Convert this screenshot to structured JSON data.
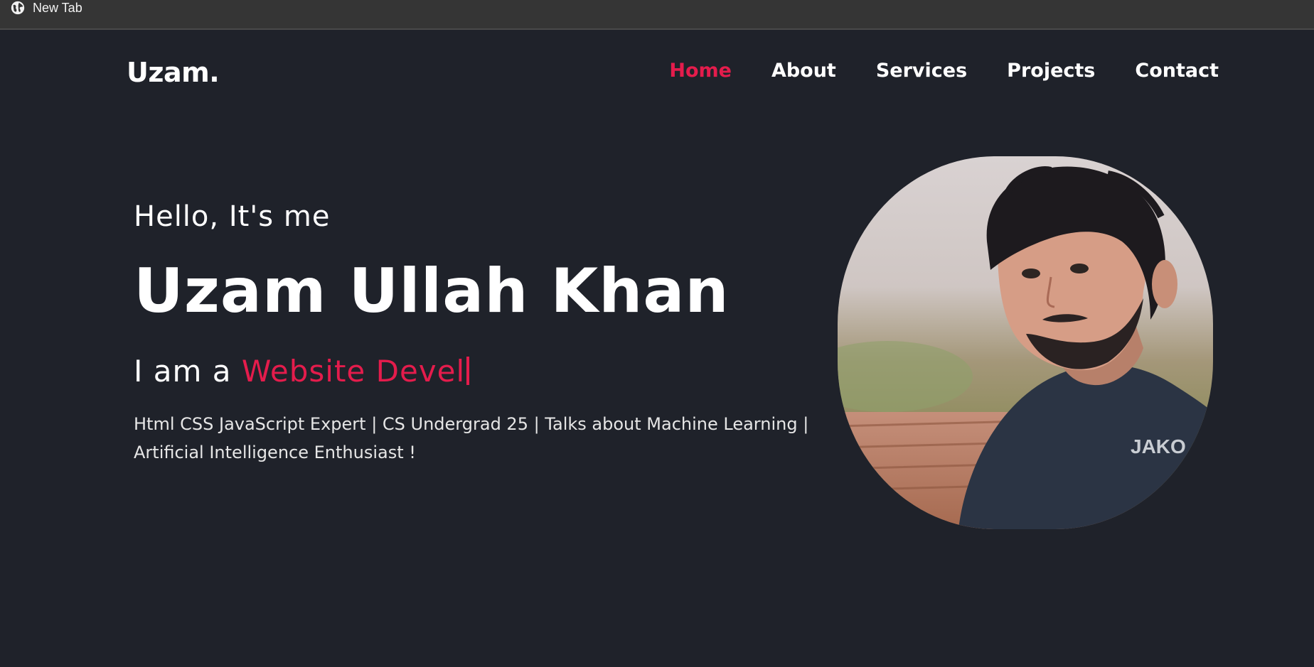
{
  "browser": {
    "tab_title": "New Tab",
    "tab_icon": "globe-icon"
  },
  "header": {
    "logo": "Uzam.",
    "nav": [
      {
        "label": "Home",
        "active": true
      },
      {
        "label": "About",
        "active": false
      },
      {
        "label": "Services",
        "active": false
      },
      {
        "label": "Projects",
        "active": false
      },
      {
        "label": "Contact",
        "active": false
      }
    ]
  },
  "hero": {
    "greeting": "Hello, It's me",
    "name": "Uzam Ullah Khan",
    "role_prefix": "I am a",
    "role_typed": "Website Devel",
    "bio": "Html CSS JavaScript Expert | CS Undergrad 25 | Talks about Machine Learning | Artificial Intelligence Enthusiast !",
    "portrait_shirt_text": "JAKO"
  },
  "colors": {
    "background": "#1f222a",
    "accent": "#e41c4c",
    "text": "#ffffff",
    "tabbar": "#353535"
  }
}
